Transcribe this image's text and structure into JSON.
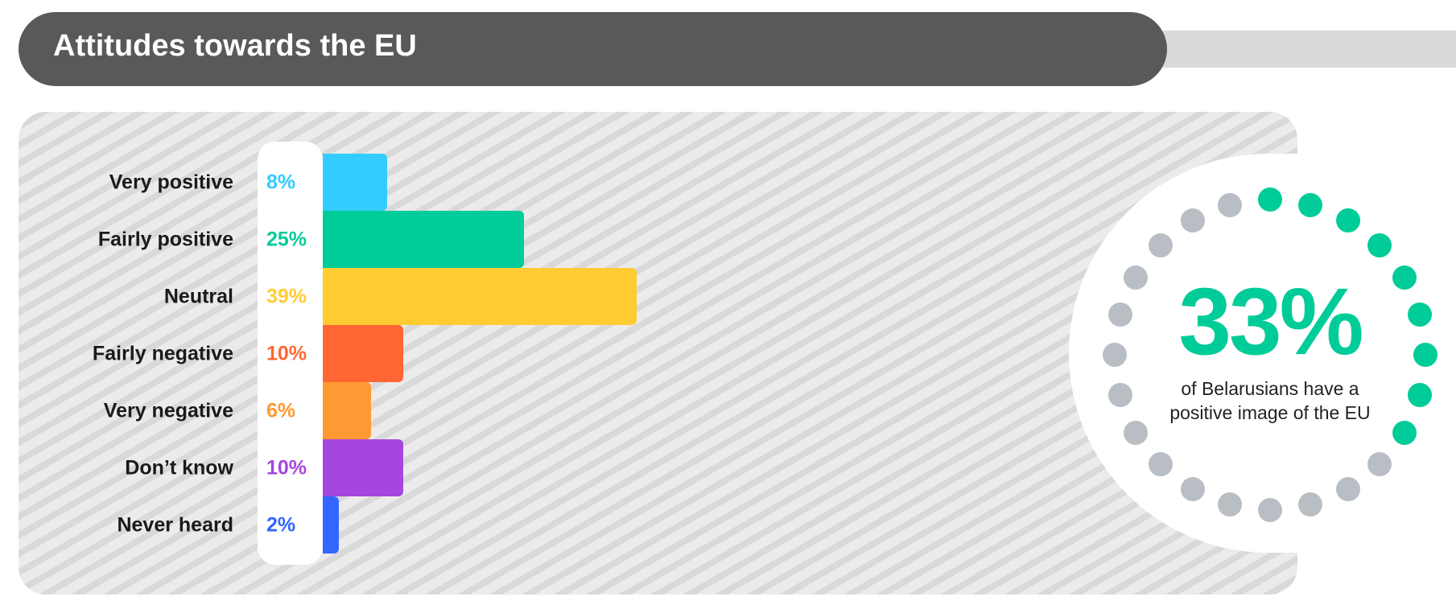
{
  "header": {
    "title": "Attitudes towards the EU"
  },
  "colors": {
    "header_bg": "#595959",
    "positive": "#00cc99",
    "ring_gray": "#b8bec4"
  },
  "chart_data": {
    "type": "bar",
    "orientation": "horizontal",
    "categories": [
      "Very positive",
      "Fairly positive",
      "Neutral",
      "Fairly negative",
      "Very negative",
      "Don’t know",
      "Never heard"
    ],
    "values": [
      8,
      25,
      39,
      10,
      6,
      10,
      2
    ],
    "value_labels": [
      "8%",
      "25%",
      "39%",
      "10%",
      "6%",
      "10%",
      "2%"
    ],
    "colors": [
      "#33ccff",
      "#00cc99",
      "#ffcc33",
      "#ff6633",
      "#ff9933",
      "#a646e0",
      "#3366ff"
    ],
    "unit": "%"
  },
  "highlight": {
    "value": "33%",
    "caption_line1": "of Belarusians have a",
    "caption_line2": "positive image of the EU",
    "ring": {
      "total_dots": 24,
      "filled_dots": 9
    }
  }
}
